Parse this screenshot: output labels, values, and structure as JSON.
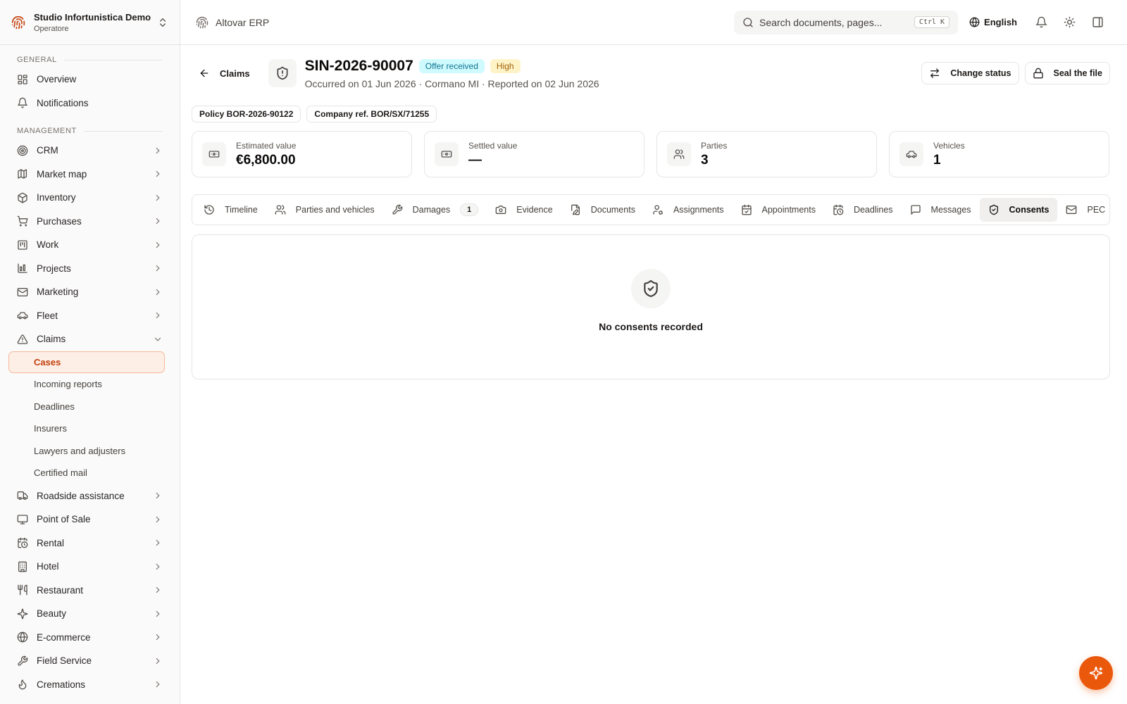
{
  "org": {
    "name": "Studio Infortunistica Demo",
    "role": "Operatore"
  },
  "sidebar": {
    "general_label": "GENERAL",
    "general_items": [
      {
        "label": "Overview",
        "icon": "dashboard-icon"
      },
      {
        "label": "Notifications",
        "icon": "bell-icon"
      }
    ],
    "management_label": "MANAGEMENT",
    "items_before": [
      {
        "label": "CRM",
        "icon": "target-icon"
      },
      {
        "label": "Market map",
        "icon": "map-icon"
      },
      {
        "label": "Inventory",
        "icon": "box-icon"
      },
      {
        "label": "Purchases",
        "icon": "cart-icon"
      },
      {
        "label": "Work",
        "icon": "kanban-icon"
      },
      {
        "label": "Projects",
        "icon": "chart-folder-icon"
      },
      {
        "label": "Marketing",
        "icon": "mail-icon"
      },
      {
        "label": "Fleet",
        "icon": "car-icon"
      }
    ],
    "claims": {
      "label": "Claims",
      "icon": "warning-icon",
      "sub_items": [
        "Cases",
        "Incoming reports",
        "Deadlines",
        "Insurers",
        "Lawyers and adjusters",
        "Certified mail"
      ],
      "active": "Cases"
    },
    "items_after": [
      {
        "label": "Roadside assistance",
        "icon": "truck-icon"
      },
      {
        "label": "Point of Sale",
        "icon": "monitor-icon"
      },
      {
        "label": "Rental",
        "icon": "calendar-clock-icon"
      },
      {
        "label": "Hotel",
        "icon": "building-icon"
      },
      {
        "label": "Restaurant",
        "icon": "utensils-icon"
      },
      {
        "label": "Beauty",
        "icon": "sparkle-icon"
      },
      {
        "label": "E-commerce",
        "icon": "globe-icon"
      },
      {
        "label": "Field Service",
        "icon": "wrench-icon"
      },
      {
        "label": "Cremations",
        "icon": "flame-icon"
      }
    ]
  },
  "topbar": {
    "app_name": "Altovar ERP",
    "search_placeholder": "Search documents, pages...",
    "search_shortcut": "Ctrl K",
    "language": "English"
  },
  "case": {
    "back_label": "Claims",
    "id": "SIN-2026-90007",
    "status_badge": "Offer received",
    "priority_badge": "High",
    "subtitle": "Occurred on 01 Jun 2026 · Cormano MI · Reported on 02 Jun 2026",
    "refs": [
      "Policy BOR-2026-90122",
      "Company ref. BOR/SX/71255"
    ],
    "actions": {
      "change_status": "Change status",
      "seal": "Seal the file"
    },
    "colors": {
      "accent": "#ea580c",
      "status_bg": "#cffafe",
      "priority_bg": "#fef3c7"
    }
  },
  "stats": [
    {
      "label": "Estimated value",
      "value": "€6,800.00",
      "icon": "banknote-icon"
    },
    {
      "label": "Settled value",
      "value": "—",
      "icon": "banknote-icon"
    },
    {
      "label": "Parties",
      "value": "3",
      "icon": "users-icon"
    },
    {
      "label": "Vehicles",
      "value": "1",
      "icon": "car-icon"
    }
  ],
  "tabs": [
    {
      "label": "Timeline",
      "icon": "history-icon"
    },
    {
      "label": "Parties and vehicles",
      "icon": "users-icon"
    },
    {
      "label": "Damages",
      "icon": "wrench-icon",
      "count": "1"
    },
    {
      "label": "Evidence",
      "icon": "camera-icon"
    },
    {
      "label": "Documents",
      "icon": "file-edit-icon"
    },
    {
      "label": "Assignments",
      "icon": "user-cog-icon"
    },
    {
      "label": "Appointments",
      "icon": "calendar-check-icon"
    },
    {
      "label": "Deadlines",
      "icon": "calendar-clock-icon"
    },
    {
      "label": "Messages",
      "icon": "message-icon"
    },
    {
      "label": "Consents",
      "icon": "shield-check-icon",
      "active": true
    },
    {
      "label": "PEC",
      "icon": "mail-icon"
    }
  ],
  "consents": {
    "empty_text": "No consents recorded"
  }
}
